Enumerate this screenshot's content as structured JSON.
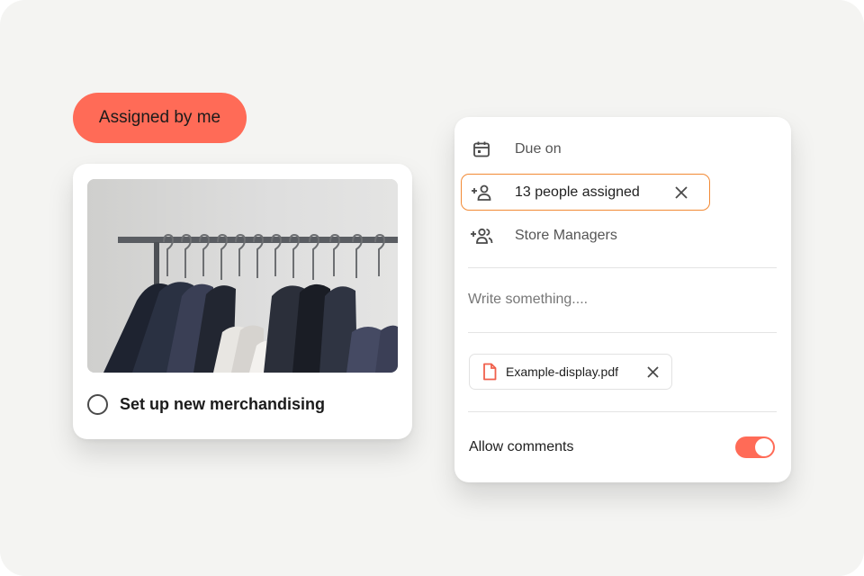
{
  "filter": {
    "label": "Assigned by me"
  },
  "task": {
    "title": "Set up new merchandising",
    "image_icon": "clothing-rack-photo"
  },
  "panel": {
    "due": {
      "label": "Due on",
      "icon": "calendar-icon"
    },
    "assignees": {
      "label": "13 people assigned",
      "icon": "add-person-icon"
    },
    "group": {
      "label": "Store Managers",
      "icon": "add-group-icon"
    },
    "comment": {
      "placeholder": "Write something...."
    },
    "attachment": {
      "file_name": "Example-display.pdf",
      "icon": "pdf-file-icon"
    },
    "allow_comments": {
      "label": "Allow comments",
      "enabled": true
    }
  },
  "colors": {
    "accent": "#ff6b57",
    "highlight_border": "#f28a35",
    "background": "#f4f4f2"
  }
}
